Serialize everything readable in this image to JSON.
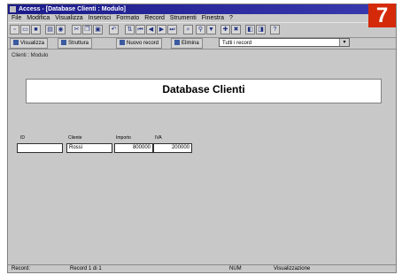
{
  "window": {
    "title": "Access - [Database Clienti : Modulo]",
    "menu": [
      "File",
      "Modifica",
      "Visualizza",
      "Inserisci",
      "Formato",
      "Record",
      "Strumenti",
      "Finestra",
      "?"
    ]
  },
  "toolbar2": {
    "btn1": "Visualizza",
    "btn2": "Struttura",
    "btn3": "Nuovo record",
    "btn4": "Elimina",
    "combo_value": "Tutti i record"
  },
  "breadcrumb": "Clienti : Modulo",
  "form": {
    "title": "Database Clienti",
    "fields": [
      {
        "label": "ID",
        "value": ""
      },
      {
        "label": "Cliente",
        "value": "Rossi"
      },
      {
        "label": "Importo",
        "value": "800000"
      },
      {
        "label": "IVA",
        "value": "200000"
      }
    ]
  },
  "status": {
    "left": "Record:",
    "record": "Record 1 di 1",
    "num": "NUM",
    "mode": "Visualizzazione"
  },
  "badge": "7",
  "colors": {
    "badge": "#d42a0a",
    "titlebar": "#1b1b8a"
  }
}
